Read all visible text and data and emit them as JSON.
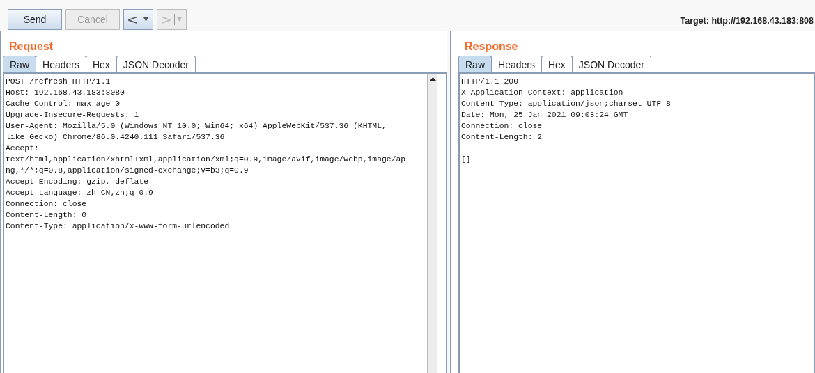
{
  "toolbar": {
    "buttons": [
      {
        "label": "Send",
        "disabled": false
      },
      {
        "label": "Cancel",
        "disabled": true
      }
    ],
    "nav": [
      {
        "label": "<",
        "disabled": false
      },
      {
        "label": ">",
        "disabled": true
      }
    ],
    "target": "Target: http://192.168.43.183:808"
  },
  "panels": [
    {
      "title": "Request",
      "tabs": [
        {
          "label": "Raw",
          "selected": true
        },
        {
          "label": "Headers",
          "selected": false
        },
        {
          "label": "Hex",
          "selected": false
        },
        {
          "label": "JSON Decoder",
          "selected": false
        }
      ],
      "scrollbar": true,
      "lines": [
        "POST /refresh HTTP/1.1",
        "Host: 192.168.43.183:8080",
        "Cache-Control: max-age=0",
        "Upgrade-Insecure-Requests: 1",
        "User-Agent: Mozilla/5.0 (Windows NT 10.0; Win64; x64) AppleWebKit/537.36 (KHTML,",
        "like Gecko) Chrome/86.0.4240.111 Safari/537.36",
        "Accept:",
        "text/html,application/xhtml+xml,application/xml;q=0.9,image/avif,image/webp,image/ap",
        "ng,*/*;q=0.8,application/signed-exchange;v=b3;q=0.9",
        "Accept-Encoding: gzip, deflate",
        "Accept-Language: zh-CN,zh;q=0.9",
        "Connection: close",
        "Content-Length: 0",
        "Content-Type: application/x-www-form-urlencoded"
      ]
    },
    {
      "title": "Response",
      "tabs": [
        {
          "label": "Raw",
          "selected": true
        },
        {
          "label": "Headers",
          "selected": false
        },
        {
          "label": "Hex",
          "selected": false
        },
        {
          "label": "JSON Decoder",
          "selected": false
        }
      ],
      "scrollbar": false,
      "lines": [
        "HTTP/1.1 200",
        "X-Application-Context: application",
        "Content-Type: application/json;charset=UTF-8",
        "Date: Mon, 25 Jan 2021 09:03:24 GMT",
        "Connection: close",
        "Content-Length: 2"
      ],
      "body": "[]"
    }
  ]
}
